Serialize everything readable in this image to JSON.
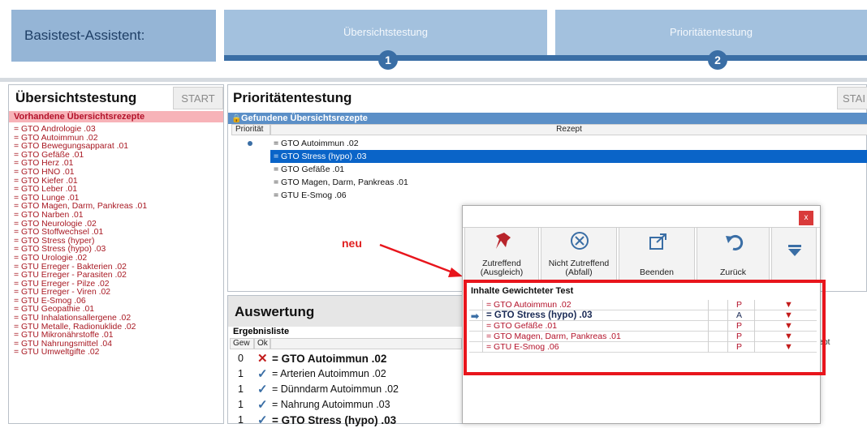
{
  "header": {
    "title": "Basistest-Assistent:",
    "step1_label": "Übersichtstestung",
    "step1_num": "1",
    "step2_label": "Prioritätentestung",
    "step2_num": "2"
  },
  "left": {
    "title": "Übersichtstestung",
    "start": "START",
    "section": "Vorhandene Übersichtsrezepte",
    "items": [
      "= GTO Andrologie .03",
      "= GTO Autoimmun .02",
      "= GTO Bewegungsapparat .01",
      "= GTO Gefäße .01",
      "= GTO Herz .01",
      "= GTO HNO .01",
      "= GTO Kiefer .01",
      "= GTO Leber .01",
      "= GTO Lunge .01",
      "= GTO Magen, Darm, Pankreas .01",
      "= GTO Narben .01",
      "= GTO Neurologie .02",
      "= GTO Stoffwechsel .01",
      "= GTO Stress (hyper)",
      "= GTO Stress (hypo) .03",
      "= GTO Urologie .02",
      "= GTU Erreger - Bakterien .02",
      "= GTU Erreger - Parasiten .02",
      "= GTU Erreger - Pilze .02",
      "= GTU Erreger - Viren .02",
      "= GTU E-Smog .06",
      "= GTU Geopathie .01",
      "= GTU Inhalationsallergene .02",
      "= GTU Metalle, Radionuklide .02",
      "= GTU Mikronährstoffe .01",
      "= GTU Nahrungsmittel .04",
      "= GTU Umweltgifte .02"
    ]
  },
  "right": {
    "title": "Prioritätentestung",
    "start": "STAI",
    "section": "Gefundene Übersichtsrezepte",
    "col_prio": "Priorität",
    "col_rezept": "Rezept",
    "rows": [
      "= GTO Autoimmun .02",
      "= GTO Stress (hypo) .03",
      "= GTO Gefäße .01",
      "= GTO Magen, Darm, Pankreas .01",
      "= GTU E-Smog .06"
    ],
    "selected_index": 1
  },
  "auswertung": {
    "title": "Auswertung",
    "sub": "Ergebnisliste",
    "col_gew": "Gew",
    "col_ok": "Ok",
    "col_rezept_partial": "ezept",
    "rows": [
      {
        "gew": "0",
        "mark": "✕",
        "text": "= GTO Autoimmun .02",
        "bold": true
      },
      {
        "gew": "1",
        "mark": "✓",
        "text": "= Arterien Autoimmun .02",
        "bold": false
      },
      {
        "gew": "1",
        "mark": "✓",
        "text": "= Dünndarm Autoimmun .02",
        "bold": false
      },
      {
        "gew": "1",
        "mark": "✓",
        "text": "= Nahrung Autoimmun .03",
        "bold": false
      },
      {
        "gew": "1",
        "mark": "✓",
        "text": "= GTO Stress (hypo) .03",
        "bold": true
      }
    ]
  },
  "annotation": {
    "neu": "neu"
  },
  "dialog": {
    "close": "x",
    "btn_zutreffend_1": "Zutreffend",
    "btn_zutreffend_2": "(Ausgleich)",
    "btn_nicht_1": "Nicht Zutreffend",
    "btn_nicht_2": "(Abfall)",
    "btn_beenden": "Beenden",
    "btn_zurueck": "Zurück",
    "section": "Inhalte Gewichteter Test",
    "rows": [
      {
        "text": "= GTO Autoimmun .02",
        "flag": "P",
        "active": false
      },
      {
        "text": "= GTO Stress (hypo) .03",
        "flag": "A",
        "active": true
      },
      {
        "text": "= GTO Gefäße .01",
        "flag": "P",
        "active": false
      },
      {
        "text": "= GTO Magen, Darm, Pankreas .01",
        "flag": "P",
        "active": false
      },
      {
        "text": "= GTU E-Smog .06",
        "flag": "P",
        "active": false
      }
    ]
  },
  "colors": {
    "header_blue": "#95b5d6",
    "step_dark": "#3a6ea5",
    "red_text": "#a81822",
    "red_box": "#e8151c",
    "selection_blue": "#0a64c8"
  }
}
